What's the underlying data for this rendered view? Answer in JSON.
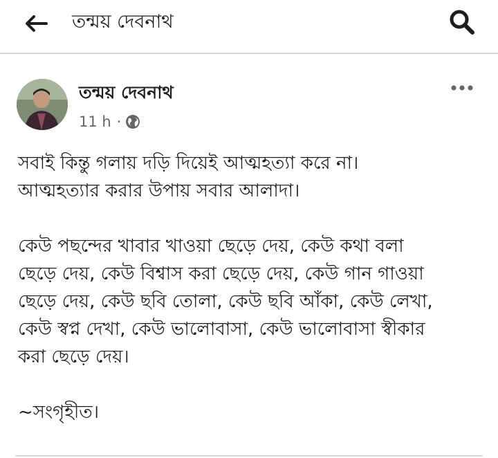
{
  "header": {
    "title": "তন্ময় দেবনাথ",
    "back_icon": "arrow-left-icon",
    "search_icon": "search-icon"
  },
  "post": {
    "author": "তন্ময় দেবনাথ",
    "time": "11 h",
    "separator": "·",
    "audience_icon": "globe-icon",
    "more_icon": "more-dots-icon",
    "paragraphs": [
      "সবাই কিন্তু গলায় দড়ি দিয়েই আত্মহত্যা করে না।\nআত্মহত্যার করার উপায় সবার আলাদা।",
      "কেউ পছন্দের খাবার খাওয়া ছেড়ে দেয়, কেউ কথা বলা\nছেড়ে দেয়, কেউ বিশ্বাস করা ছেড়ে দেয়, কেউ গান গাওয়া\nছেড়ে দেয়, কেউ ছবি তোলা, কেউ ছবি আঁকা, কেউ লেখা,\nকেউ স্বপ্ন দেখা, কেউ ভালোবাসা, কেউ ভালোবাসা স্বীকার\nকরা ছেড়ে দেয়।",
      "~সংগৃহীত।"
    ]
  },
  "colors": {
    "text": "#1c1e21",
    "meta": "#65676b",
    "divider": "#d6d7da"
  }
}
